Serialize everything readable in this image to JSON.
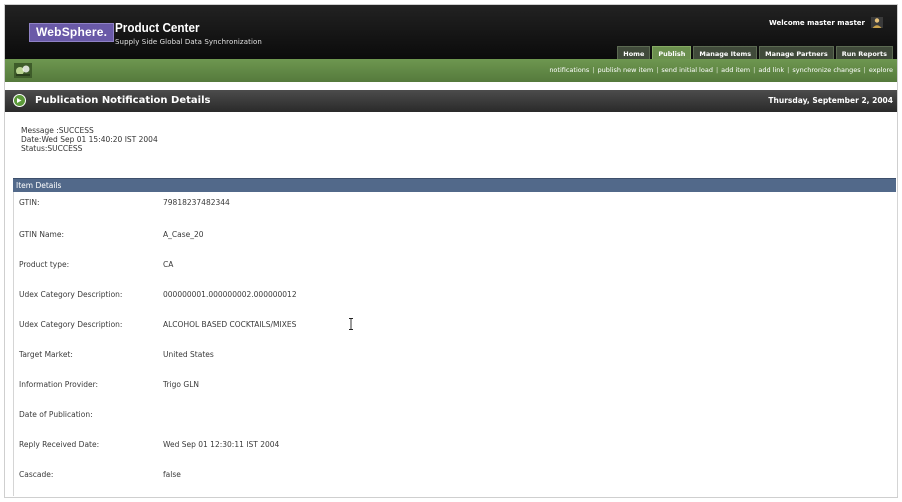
{
  "header": {
    "brand": "WebSphere.",
    "product_title": "Product Center",
    "product_subtitle": "Supply Side Global Data Synchronization",
    "welcome_text": "Welcome  master master",
    "tabs": [
      {
        "label": "Home",
        "active": false
      },
      {
        "label": "Publish",
        "active": true
      },
      {
        "label": "Manage Items",
        "active": false
      },
      {
        "label": "Manage Partners",
        "active": false
      },
      {
        "label": "Run Reports",
        "active": false
      }
    ]
  },
  "navbar": {
    "links": [
      "notifications",
      "publish new item",
      "send initial load",
      "add item",
      "add link",
      "synchronize changes",
      "explore"
    ]
  },
  "page": {
    "title": "Publication Notification Details",
    "date": "Thursday, September 2, 2004"
  },
  "message": {
    "message_line": "Message :SUCCESS",
    "date_line": "Date:Wed Sep 01 15:40:20 IST 2004",
    "status_line": "Status:SUCCESS"
  },
  "item_details": {
    "header": "Item Details",
    "rows": [
      {
        "label": "GTIN:",
        "value": "79818237482344"
      },
      {
        "label": "GTIN Name:",
        "value": "A_Case_20"
      },
      {
        "label": "Product type:",
        "value": "CA"
      },
      {
        "label": "Udex Category Description:",
        "value": "000000001.000000002.000000012"
      },
      {
        "label": "Udex Category Description:",
        "value": "ALCOHOL BASED COCKTAILS/MIXES"
      },
      {
        "label": "Target Market:",
        "value": "United States"
      },
      {
        "label": "Information Provider:",
        "value": "Trigo GLN"
      },
      {
        "label": "Date of Publication:",
        "value": ""
      },
      {
        "label": "Reply Received Date:",
        "value": "Wed Sep 01 12:30:11 IST 2004"
      },
      {
        "label": "Cascade:",
        "value": "false"
      }
    ]
  },
  "colors": {
    "header_bg": "#111111",
    "nav_green": "#63894a",
    "title_bar": "#3a3a3a",
    "details_header": "#52698a",
    "logo_purple": "#6a5aa8"
  },
  "icons": [
    "user-icon",
    "gdsn-nav-icon",
    "arrow-circle-icon",
    "text-cursor-icon"
  ]
}
